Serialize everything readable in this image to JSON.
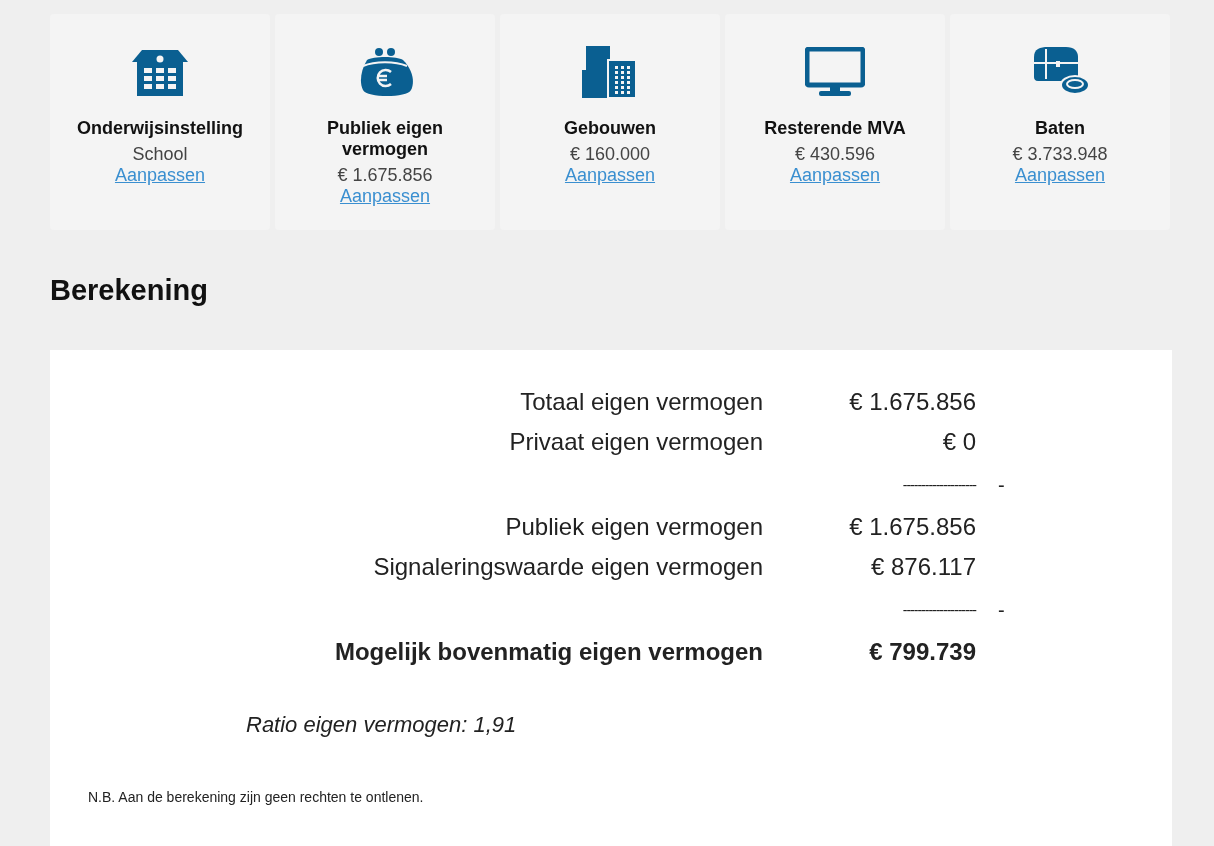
{
  "cards": [
    {
      "kind": "school",
      "title": "Onderwijsinstelling",
      "value": "School",
      "link": "Aanpassen"
    },
    {
      "kind": "purse",
      "title": "Publiek eigen vermogen",
      "value": "€ 1.675.856",
      "link": "Aanpassen"
    },
    {
      "kind": "buildings",
      "title": "Gebouwen",
      "value": "€ 160.000",
      "link": "Aanpassen"
    },
    {
      "kind": "monitor",
      "title": "Resterende MVA",
      "value": "€ 430.596",
      "link": "Aanpassen"
    },
    {
      "kind": "chest",
      "title": "Baten",
      "value": "€ 3.733.948",
      "link": "Aanpassen"
    }
  ],
  "heading": "Berekening",
  "calculation": [
    {
      "kind": "line",
      "label": "Totaal eigen vermogen",
      "value": "€ 1.675.856"
    },
    {
      "kind": "line",
      "label": "Privaat eigen vermogen",
      "value": "€ 0"
    },
    {
      "kind": "separator",
      "value": "--------------------",
      "operator": "-"
    },
    {
      "kind": "line",
      "label": "Publiek eigen vermogen",
      "value": "€ 1.675.856"
    },
    {
      "kind": "line",
      "label": "Signaleringswaarde eigen vermogen",
      "value": "€ 876.117"
    },
    {
      "kind": "separator",
      "value": "--------------------",
      "operator": "-"
    },
    {
      "kind": "total",
      "label": "Mogelijk bovenmatig eigen vermogen",
      "value": "€ 799.739"
    }
  ],
  "ratio": "Ratio eigen vermogen: 1,91",
  "note": "N.B. Aan de berekening zijn geen rechten te ontlenen."
}
